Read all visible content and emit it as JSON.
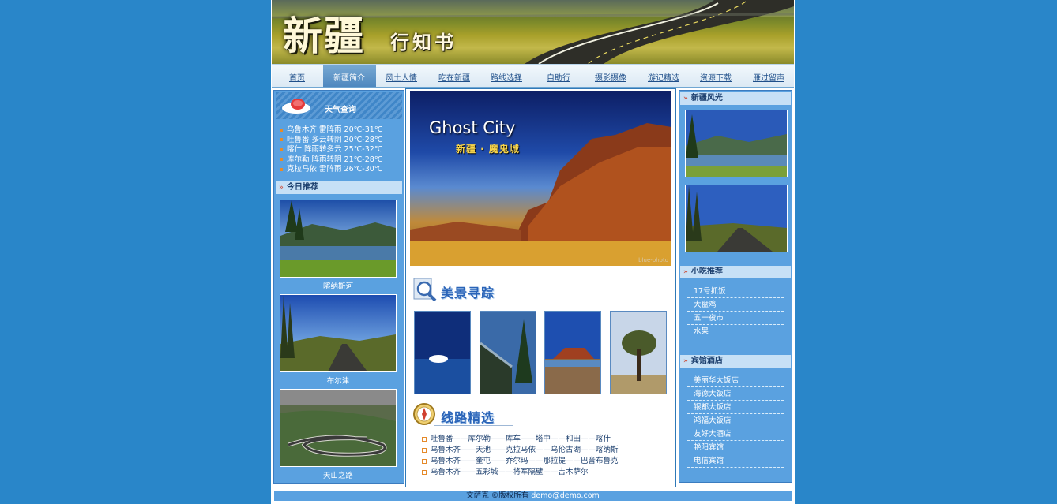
{
  "banner": {
    "title": "新疆",
    "subtitle": "行知书"
  },
  "nav": {
    "items": [
      {
        "label": "首页"
      },
      {
        "label": "新疆简介"
      },
      {
        "label": "风土人情"
      },
      {
        "label": "吃在新疆"
      },
      {
        "label": "路线选择"
      },
      {
        "label": "自助行"
      },
      {
        "label": "摄影摄像"
      },
      {
        "label": "游记精选"
      },
      {
        "label": "资源下载"
      },
      {
        "label": "雁过留声"
      }
    ],
    "active_index": 1
  },
  "weather": {
    "title": "天气查询",
    "rows": [
      "乌鲁木齐   雷阵雨 20℃-31℃",
      "吐鲁番   多云转阴 20℃-28℃",
      "喀什   阵雨转多云 25℃-32℃",
      "库尔勒   阵雨转阴 21℃-28℃",
      "克拉马依   雷阵雨 26℃-30℃"
    ]
  },
  "today": {
    "title": "今日推荐",
    "items": [
      {
        "caption": "喀纳斯河"
      },
      {
        "caption": "布尔津"
      },
      {
        "caption": "天山之路"
      }
    ]
  },
  "hero": {
    "title_en": "Ghost City",
    "title_cn": "新疆 · 魔鬼城",
    "watermark": "blue-photo"
  },
  "scenery": {
    "title": "美景寻踪"
  },
  "routes": {
    "title": "线路精选",
    "items": [
      "吐鲁番——库尔勒——库车——塔中——和田——喀什",
      "乌鲁木齐——天池——克拉马依——乌伦古湖——喀纳斯",
      "乌鲁木齐——奎屯——乔尔玛——那拉提——巴音布鲁克",
      "乌鲁木齐——五彩城——将军隔壁——吉木萨尔"
    ]
  },
  "right": {
    "scenery_title": "新疆风光",
    "food_title": "小吃推荐",
    "food_items": [
      "17号抓饭",
      "大盘鸡",
      "五一夜市",
      "水果"
    ],
    "hotel_title": "宾馆酒店",
    "hotel_items": [
      "美丽华大饭店",
      "海德大饭店",
      "银都大饭店",
      "鸿福大饭店",
      "友好大酒店",
      "艳阳宾馆",
      "电信宾馆"
    ]
  },
  "footer": {
    "text": "文萨克 ©版权所有",
    "email": "demo@demo.com"
  },
  "colors": {
    "background": "#2986c9",
    "panel": "#5aa1e0",
    "section_header": "#c6e0f6",
    "accent_orange": "#e58a2a"
  }
}
